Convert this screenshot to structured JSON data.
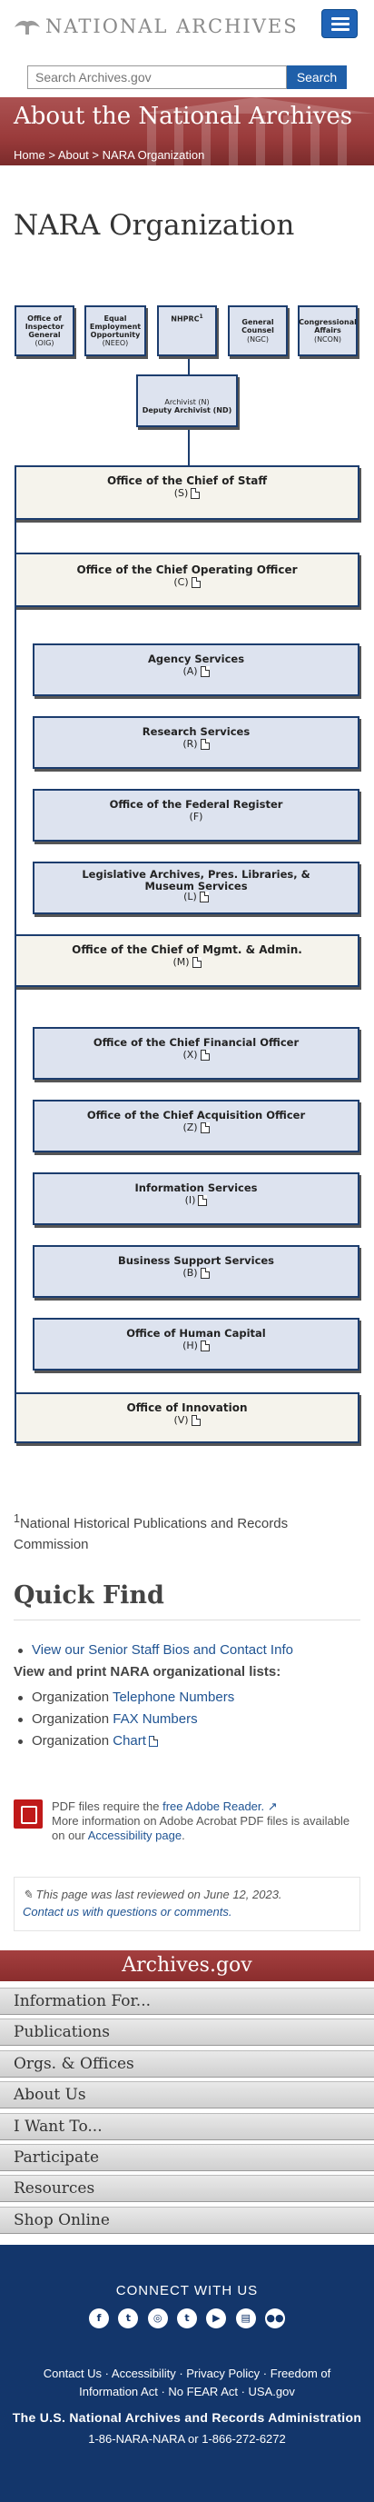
{
  "header": {
    "logo_text": "NATIONAL ARCHIVES",
    "menu_icon": "hamburger-icon"
  },
  "search": {
    "placeholder": "Search Archives.gov",
    "button": "Search"
  },
  "hero": {
    "title": "About the National Archives",
    "breadcrumb": [
      "Home",
      "About",
      "NARA Organization"
    ],
    "separator": ">"
  },
  "page_title": "NARA Organization",
  "org_chart": {
    "top_row": [
      {
        "name": "Office of Inspector General",
        "abbr": "(OIG)"
      },
      {
        "name": "Equal Employment Opportunity",
        "abbr": "(NEEO)"
      },
      {
        "name": "NHPRC",
        "sup": "1",
        "abbr": ""
      },
      {
        "name": "General Counsel",
        "abbr": "(NGC)"
      },
      {
        "name": "Congressional Affairs",
        "abbr": "(NCON)"
      }
    ],
    "archivist": {
      "line1": "Archivist (N)",
      "line2": "Deputy Archivist (ND)"
    },
    "offices": [
      {
        "name": "Office of the Chief of Staff",
        "letter": "(S)",
        "pdf": true
      },
      {
        "name": "Office of the Chief Operating Officer",
        "letter": "(C)",
        "pdf": true
      },
      {
        "name": "Agency Services",
        "letter": "(A)",
        "pdf": true
      },
      {
        "name": "Research Services",
        "letter": "(R)",
        "pdf": true
      },
      {
        "name": "Office of the Federal Register",
        "letter": "(F)",
        "pdf": false
      },
      {
        "name": "Legislative Archives, Pres. Libraries, & Museum Services",
        "letter": "(L)",
        "pdf": true
      },
      {
        "name": "Office of the Chief of Mgmt. & Admin.",
        "letter": "(M)",
        "pdf": true
      },
      {
        "name": "Office of the Chief Financial Officer",
        "letter": "(X)",
        "pdf": true
      },
      {
        "name": "Office of the Chief Acquisition Officer",
        "letter": "(Z)",
        "pdf": true
      },
      {
        "name": "Information Services",
        "letter": "(I)",
        "pdf": true
      },
      {
        "name": "Business Support Services",
        "letter": "(B)",
        "pdf": true
      },
      {
        "name": "Office of Human Capital",
        "letter": "(H)",
        "pdf": true
      },
      {
        "name": "Office of Innovation",
        "letter": "(V)",
        "pdf": true
      }
    ]
  },
  "footnote": {
    "sup": "1",
    "text": "National Historical Publications and Records Commission"
  },
  "quick_find": {
    "title": "Quick Find",
    "link1": "View our Senior Staff Bios and Contact Info",
    "subhead": "View and print NARA organizational lists:",
    "items": [
      {
        "prefix": "Organization",
        "link": "Telephone Numbers"
      },
      {
        "prefix": "Organization",
        "link": "FAX Numbers"
      },
      {
        "prefix": "Organization",
        "link": "Chart"
      }
    ]
  },
  "pdf_note": {
    "text1": "PDF files require the ",
    "link1": "free Adobe Reader.",
    "text2": "More information on Adobe Acrobat PDF files is available on our ",
    "link2": "Accessibility page",
    "text3": "."
  },
  "reviewed": {
    "text": "This page was last reviewed on June 12, 2023.",
    "contact": "Contact us with questions or comments."
  },
  "footer": {
    "site": "Archives.gov",
    "nav": [
      "Information For...",
      "Publications",
      "Orgs. & Offices",
      "About Us",
      "I Want To...",
      "Participate",
      "Resources",
      "Shop Online"
    ],
    "connect": "CONNECT WITH US",
    "social": [
      "facebook-icon",
      "twitter-icon",
      "instagram-icon",
      "tumblr-icon",
      "youtube-icon",
      "blog-icon",
      "flickr-icon"
    ],
    "links": [
      "Contact Us",
      "Accessibility",
      "Privacy Policy",
      "Freedom of Information Act",
      "No FEAR Act",
      "USA.gov"
    ],
    "link_sep": " · ",
    "agency": "The U.S. National Archives and Records Administration",
    "phone": "1-86-NARA-NARA or 1-866-272-6272"
  },
  "colors": {
    "accent": "#1f5fa9",
    "hero": "#9a3b3b",
    "footer": "#13366b",
    "box_blue": "#dde3ef",
    "box_cream": "#f5f3ec"
  }
}
